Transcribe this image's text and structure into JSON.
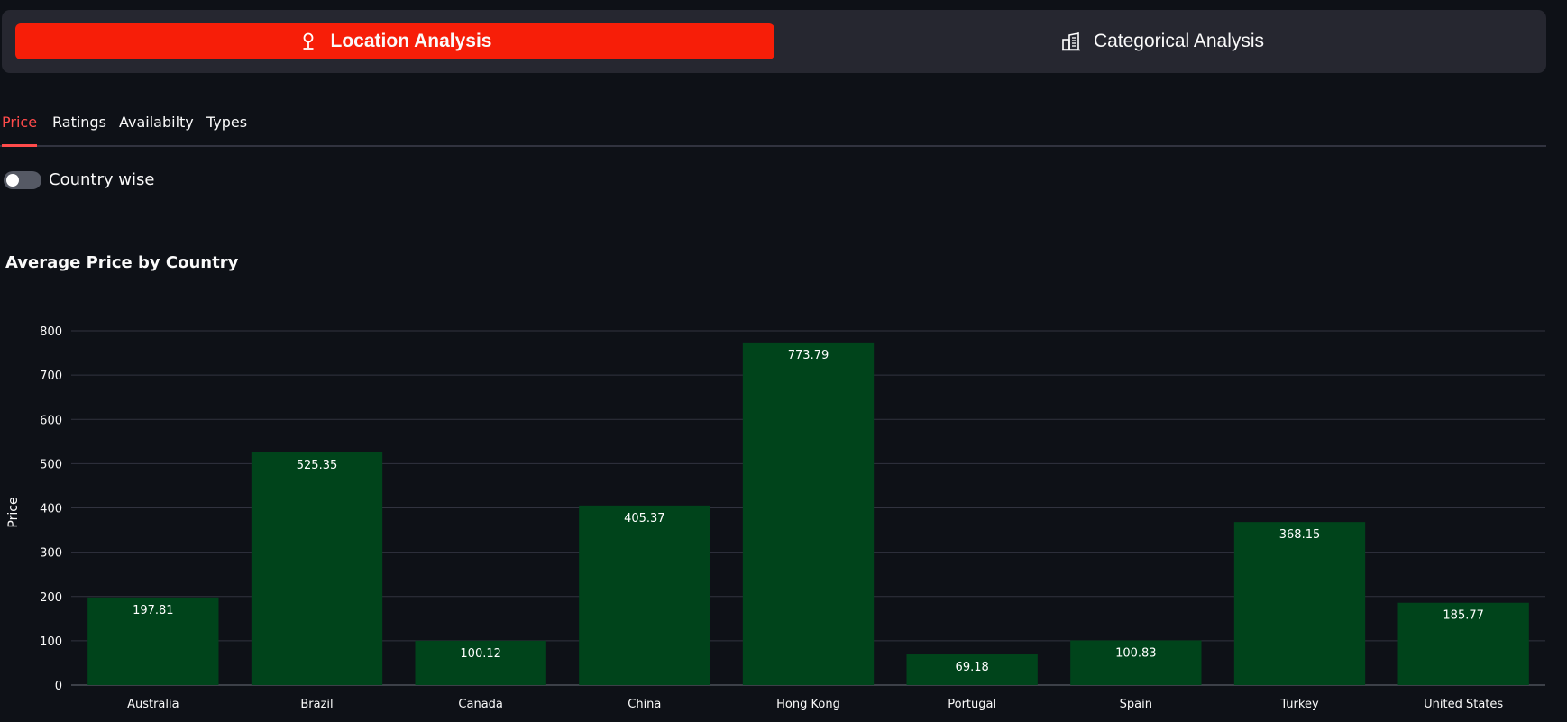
{
  "nav": {
    "location": {
      "label": "Location Analysis",
      "icon": "location-pin-icon"
    },
    "categorical": {
      "label": "Categorical Analysis",
      "icon": "building-icon"
    }
  },
  "tabs": [
    {
      "label": "Price",
      "active": true
    },
    {
      "label": "Ratings",
      "active": false
    },
    {
      "label": "Availabilty",
      "active": false
    },
    {
      "label": "Types",
      "active": false
    }
  ],
  "toggle": {
    "label": "Country wise",
    "on": false
  },
  "colors": {
    "accent": "#ff4b4b",
    "active_nav": "#f71e08",
    "bar": "#00441b",
    "background": "#0e1117"
  },
  "chart_data": {
    "type": "bar",
    "title": "Average Price by Country",
    "xlabel": "",
    "ylabel": "Price",
    "ylim": [
      0,
      800
    ],
    "yticks": [
      0,
      100,
      200,
      300,
      400,
      500,
      600,
      700,
      800
    ],
    "grid": true,
    "categories": [
      "Australia",
      "Brazil",
      "Canada",
      "China",
      "Hong Kong",
      "Portugal",
      "Spain",
      "Turkey",
      "United States"
    ],
    "values": [
      197.81,
      525.35,
      100.12,
      405.37,
      773.79,
      69.18,
      100.83,
      368.15,
      185.77
    ],
    "data_labels": [
      "197.81",
      "525.35",
      "100.12",
      "405.37",
      "773.79",
      "69.18",
      "100.83",
      "368.15",
      "185.77"
    ]
  }
}
